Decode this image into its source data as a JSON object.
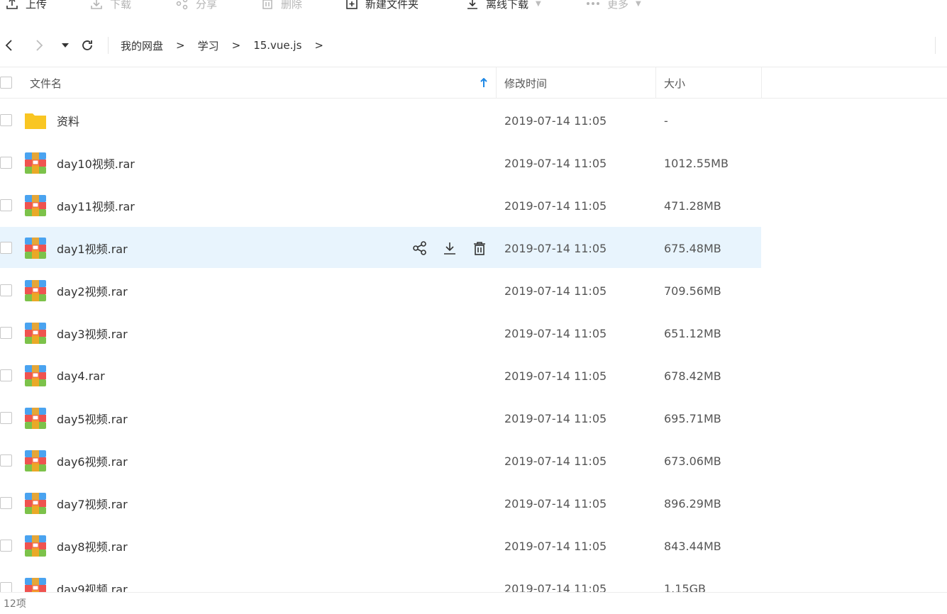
{
  "toolbar": {
    "upload": "上传",
    "download": "下载",
    "share": "分享",
    "delete": "删除",
    "new_folder": "新建文件夹",
    "offline_download": "离线下载",
    "more": "更多"
  },
  "nav": {
    "breadcrumb": [
      "我的网盘",
      "学习",
      "15.vue.js"
    ],
    "separator": ">"
  },
  "table": {
    "columns": {
      "name": "文件名",
      "modified": "修改时间",
      "size": "大小"
    },
    "rows": [
      {
        "name": "资料",
        "type": "folder",
        "modified": "2019-07-14 11:05",
        "size": "-"
      },
      {
        "name": "day10视频.rar",
        "type": "archive",
        "modified": "2019-07-14 11:05",
        "size": "1012.55MB"
      },
      {
        "name": "day11视频.rar",
        "type": "archive",
        "modified": "2019-07-14 11:05",
        "size": "471.28MB"
      },
      {
        "name": "day1视频.rar",
        "type": "archive",
        "modified": "2019-07-14 11:05",
        "size": "675.48MB",
        "hovered": true
      },
      {
        "name": "day2视频.rar",
        "type": "archive",
        "modified": "2019-07-14 11:05",
        "size": "709.56MB"
      },
      {
        "name": "day3视频.rar",
        "type": "archive",
        "modified": "2019-07-14 11:05",
        "size": "651.12MB"
      },
      {
        "name": "day4.rar",
        "type": "archive",
        "modified": "2019-07-14 11:05",
        "size": "678.42MB"
      },
      {
        "name": "day5视频.rar",
        "type": "archive",
        "modified": "2019-07-14 11:05",
        "size": "695.71MB"
      },
      {
        "name": "day6视频.rar",
        "type": "archive",
        "modified": "2019-07-14 11:05",
        "size": "673.06MB"
      },
      {
        "name": "day7视频.rar",
        "type": "archive",
        "modified": "2019-07-14 11:05",
        "size": "896.29MB"
      },
      {
        "name": "day8视频.rar",
        "type": "archive",
        "modified": "2019-07-14 11:05",
        "size": "843.44MB"
      },
      {
        "name": "day9视频.rar",
        "type": "archive",
        "modified": "2019-07-14 11:05",
        "size": "1.15GB"
      }
    ]
  },
  "status": {
    "count": "12项"
  },
  "colors": {
    "accent": "#1e88e5",
    "hover_row": "#e8f4fd",
    "folder": "#f9c522",
    "archive_top": "#4aa3f0",
    "archive_mid": "#ef5350",
    "archive_bottom": "#7cc24a",
    "archive_band": "#f5a623"
  },
  "icons": {
    "upload": "upload-icon",
    "download": "download-icon",
    "share": "share-icon",
    "delete": "trash-icon",
    "new_folder": "new-folder-icon",
    "offline_download": "offline-download-icon",
    "more": "more-icon",
    "back": "chevron-left-icon",
    "forward": "chevron-right-icon",
    "history": "caret-down-icon",
    "refresh": "refresh-icon",
    "sort": "sort-up-arrow-icon",
    "folder": "folder-icon",
    "archive": "archive-icon"
  }
}
